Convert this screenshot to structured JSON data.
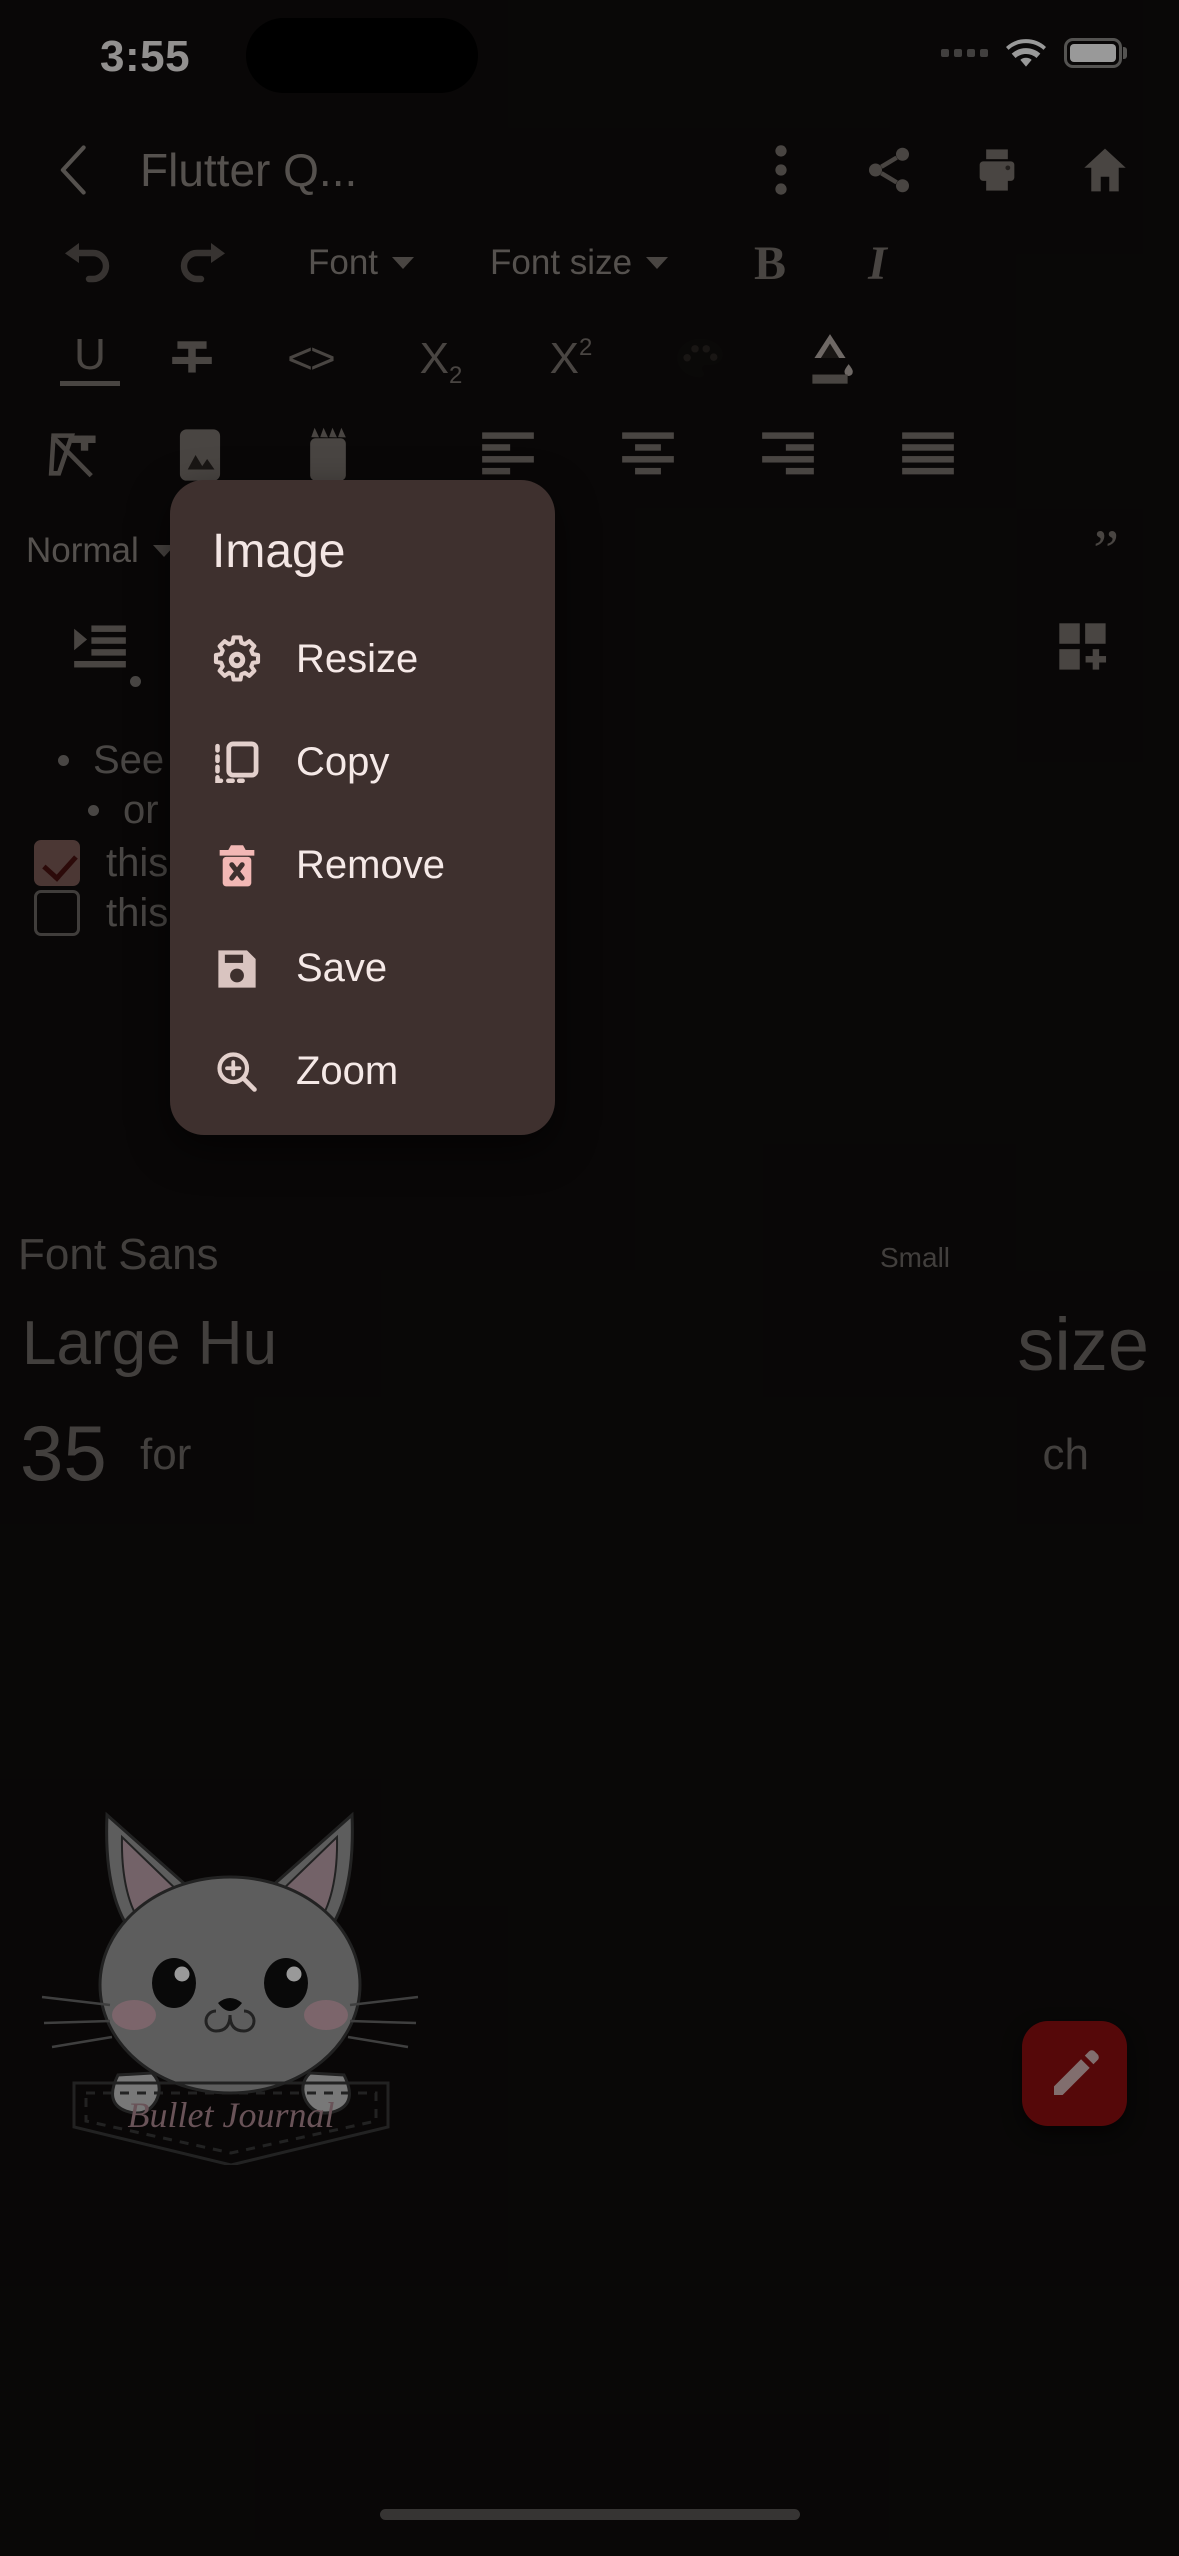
{
  "status_bar": {
    "time": "3:55",
    "icons": [
      "signal-dots",
      "wifi-icon",
      "battery-icon"
    ]
  },
  "app_bar": {
    "back_icon": "chevron-left-icon",
    "title": "Flutter Q...",
    "actions": [
      {
        "name": "overflow-menu-icon",
        "label": "more-vert"
      },
      {
        "name": "share-icon",
        "label": "share"
      },
      {
        "name": "print-icon",
        "label": "print"
      },
      {
        "name": "home-icon",
        "label": "home"
      }
    ]
  },
  "toolbar": {
    "row1": [
      {
        "type": "icon",
        "name": "undo-icon"
      },
      {
        "type": "icon",
        "name": "redo-icon"
      },
      {
        "type": "dropdown",
        "name": "font-family-dropdown",
        "label": "Font"
      },
      {
        "type": "dropdown",
        "name": "font-size-dropdown",
        "label": "Font size"
      },
      {
        "type": "glyph",
        "name": "bold-button",
        "label": "B"
      },
      {
        "type": "glyph",
        "name": "italic-button",
        "label": "I"
      }
    ],
    "row2": [
      {
        "name": "underline-button",
        "label": "U"
      },
      {
        "name": "strikethrough-button",
        "label": "S"
      },
      {
        "name": "inline-code-button",
        "label": "<>"
      },
      {
        "name": "subscript-button",
        "label": "X",
        "sub": "2"
      },
      {
        "name": "superscript-button",
        "label": "X",
        "sup": "2"
      },
      {
        "name": "text-color-palette-icon",
        "label": "palette"
      },
      {
        "name": "background-fill-icon",
        "label": "fill"
      }
    ],
    "row3": [
      {
        "name": "clear-format-icon"
      },
      {
        "name": "insert-image-icon"
      },
      {
        "name": "insert-video-icon"
      },
      {
        "name": "align-left-icon"
      },
      {
        "name": "align-center-icon"
      },
      {
        "name": "align-right-icon"
      },
      {
        "name": "align-justify-icon"
      }
    ],
    "row4": {
      "style_dropdown_label": "Normal",
      "quote_icon": "block-quote-icon"
    },
    "row5": {
      "indent_icon": "indent-increase-icon",
      "table_icon": "insert-table-icon"
    }
  },
  "document": {
    "bullets": [
      "See t",
      "or h"
    ],
    "checklist": [
      {
        "checked": true,
        "text": "this is"
      },
      {
        "checked": false,
        "text": "this is"
      }
    ],
    "font_sans_line": "Font Sans",
    "small_label": "Small",
    "large_line": "Large Hu",
    "size_line": "size",
    "number_line": "35",
    "for_line": "for",
    "ch_line": "ch",
    "illustration_caption": "Bullet Journal"
  },
  "fab": {
    "name": "edit-fab",
    "icon": "pencil-icon",
    "color": "#8e0e10"
  },
  "dialog": {
    "title": "Image",
    "background_color": "#3e302e",
    "items": [
      {
        "icon": "gear-icon",
        "label": "Resize",
        "color": "#e3d0cc"
      },
      {
        "icon": "copy-icon",
        "label": "Copy",
        "color": "#e3d0cc"
      },
      {
        "icon": "delete-trash-icon",
        "label": "Remove",
        "color": "#f2b8b5"
      },
      {
        "icon": "save-floppy-icon",
        "label": "Save",
        "color": "#d9c4c0"
      },
      {
        "icon": "zoom-in-icon",
        "label": "Zoom",
        "color": "#e3d0cc"
      }
    ]
  }
}
